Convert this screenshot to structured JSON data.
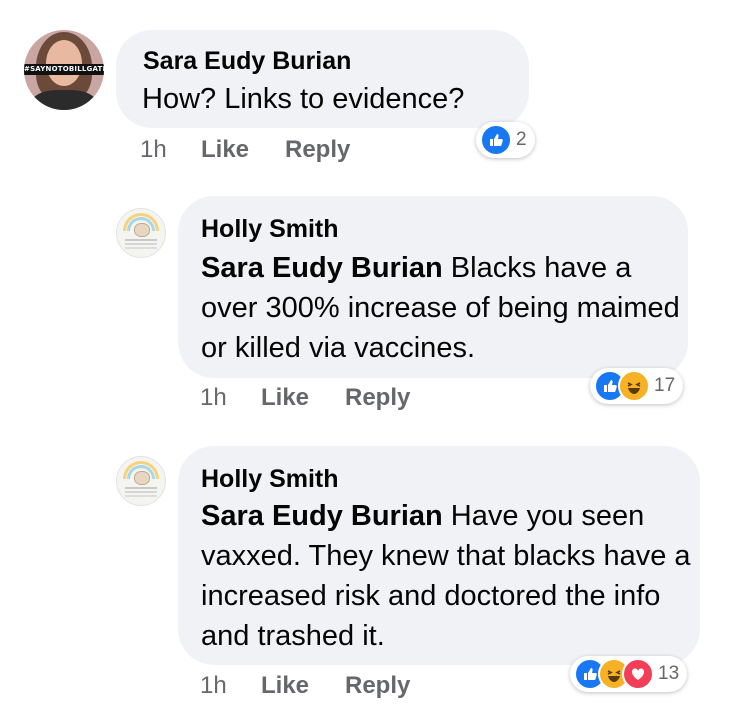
{
  "comments": [
    {
      "author": "Sara Eudy Burian",
      "avatar_banner": "#SAYNOTOBILLGATES",
      "mention": "",
      "text": "How?  Links to evidence?",
      "time": "1h",
      "like_label": "Like",
      "reply_label": "Reply",
      "reactions": [
        "like-icon"
      ],
      "reaction_count": "2"
    },
    {
      "author": "Holly Smith",
      "mention": "Sara Eudy Burian",
      "text": " Blacks have a over 300% increase of being maimed or killed via vaccines.",
      "time": "1h",
      "like_label": "Like",
      "reply_label": "Reply",
      "reactions": [
        "like-icon",
        "haha-icon"
      ],
      "reaction_count": "17"
    },
    {
      "author": "Holly Smith",
      "mention": "Sara Eudy Burian",
      "text": " Have you seen vaxxed. They knew that blacks have a increased risk and doctored the info and trashed it.",
      "time": "1h",
      "like_label": "Like",
      "reply_label": "Reply",
      "reactions": [
        "like-icon",
        "haha-icon",
        "love-icon"
      ],
      "reaction_count": "13"
    }
  ],
  "colors": {
    "bubble": "#f0f2f5",
    "meta": "#65676b",
    "like": "#1877f2",
    "haha": "#f7b125",
    "love": "#f33e58"
  }
}
